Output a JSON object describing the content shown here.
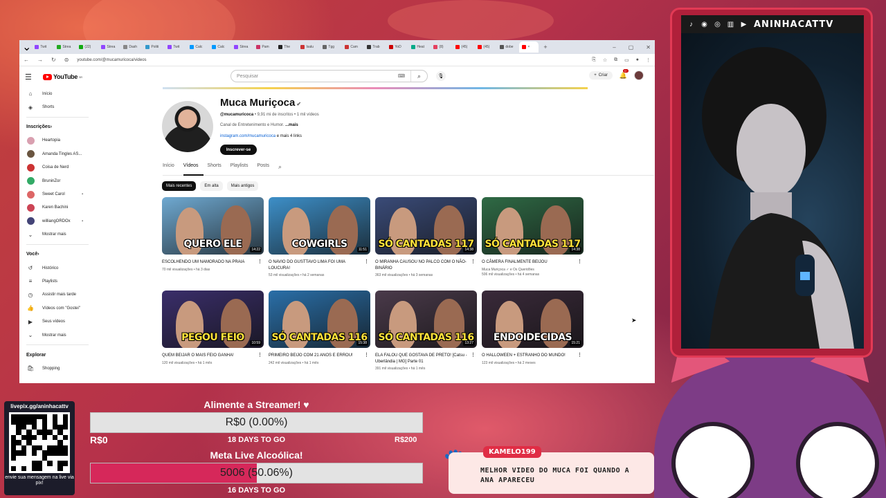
{
  "browser": {
    "tabs": [
      "Twit",
      "Strea",
      "(22)",
      "Strea",
      "Dash",
      "Politi",
      "Twit",
      "Calc",
      "Calc",
      "Strea",
      "Pam",
      "The",
      "Isalu",
      "Tgg",
      "Cam",
      "Trab",
      "YoD",
      "Heat",
      "(8)",
      "(45)",
      "(45)",
      "dobe"
    ],
    "url": "youtube.com/@mucamuricoca/videos"
  },
  "masthead": {
    "logo": "YouTube",
    "region": "BR",
    "search_placeholder": "Pesquisar",
    "create": "Criar",
    "notifications": "9+"
  },
  "sidebar": {
    "nav": [
      {
        "label": "Início",
        "icon": "home-icon"
      },
      {
        "label": "Shorts",
        "icon": "shorts-icon"
      }
    ],
    "subs_header": "Inscrições",
    "subs": [
      {
        "label": "Heartopia",
        "color": "#d9a0b0"
      },
      {
        "label": "Amanda Tingles AS...",
        "color": "#6a5540"
      },
      {
        "label": "Coisa de Nerd",
        "color": "#c33"
      },
      {
        "label": "BruninZor",
        "color": "#3a6"
      },
      {
        "label": "Sweet Carol",
        "color": "#d66"
      },
      {
        "label": "Karen Bachini",
        "color": "#c45"
      },
      {
        "label": "williangORDOx",
        "color": "#447"
      }
    ],
    "show_more": "Mostrar mais",
    "you_header": "Você",
    "you": [
      {
        "label": "Histórico",
        "icon": "history-icon"
      },
      {
        "label": "Playlists",
        "icon": "playlists-icon"
      },
      {
        "label": "Assistir mais tarde",
        "icon": "watch-later-icon"
      },
      {
        "label": "Vídeos com \"Gostei\"",
        "icon": "like-icon"
      },
      {
        "label": "Seus vídeos",
        "icon": "your-videos-icon"
      },
      {
        "label": "Mostrar mais",
        "icon": "chevron-down-icon"
      }
    ],
    "explore_header": "Explorar",
    "explore": [
      {
        "label": "Shopping",
        "icon": "shopping-icon"
      }
    ]
  },
  "channel": {
    "name": "Muca Muriçoca",
    "handle": "@mucamuricoca",
    "stats": " • 9,91 mi de inscritos • 1 mil vídeos",
    "desc": "Canal de Entretenimento e Humor.",
    "more": " ...mais",
    "link": "instagram.com/mucamuricoca",
    "link_more": " e mais 4 links",
    "subscribe": "Inscrever-se",
    "tabs": [
      "Início",
      "Vídeos",
      "Shorts",
      "Playlists",
      "Posts"
    ],
    "chips": [
      "Mais recentes",
      "Em alta",
      "Mais antigos"
    ]
  },
  "videos": [
    {
      "cap": "QUERO ELE",
      "dur": "14:22",
      "title": "ESCOLHENDO UM NAMORADO NA PRAIA",
      "meta": "70 mil visualizações • há 3 dias",
      "bg": "#6fa9d1",
      "yellow": false
    },
    {
      "cap": "COWGIRLS",
      "dur": "11:51",
      "title": "O NAVIO DO GUSTTAVO LIMA FOI UMA LOUCURA!",
      "meta": "53 mil visualizações • há 2 semanas",
      "bg": "#3d8fc8",
      "yellow": false
    },
    {
      "cap": "SÓ CANTADAS 117",
      "dur": "14:38",
      "title": "O MIRANHA CAUSOU NO PALCO COM O NÃO-BINÁRIO",
      "meta": "363 mil visualizações • há 3 semanas",
      "bg": "#3a4b78",
      "yellow": true
    },
    {
      "cap": "SÓ CANTADAS 117",
      "dur": "14:38",
      "title": "O CÂMERA FINALMENTE BEIJOU",
      "meta": "Muca Muriçoca ✓ e Os Queridões\n506 mil visualizações • há 4 semanas",
      "bg": "#2f6a45",
      "yellow": true
    },
    {
      "cap": "PEGOU FEIO",
      "dur": "10:59",
      "title": "QUEM BEIJAR O MAIS FEIO GANHA!",
      "meta": "120 mil visualizações • há 1 mês",
      "bg": "#3a2e6a",
      "yellow": true
    },
    {
      "cap": "SÓ CANTADAS 116",
      "dur": "15:38",
      "title": "PRIMEIRO BEIJO COM 21 ANOS E ERROU!",
      "meta": "242 mil visualizações • há 1 mês",
      "bg": "#2a6fa8",
      "yellow": true
    },
    {
      "cap": "SÓ CANTADAS 116",
      "dur": "13:27",
      "title": "ELA FALOU QUE GOSTAVA DE PRETO! [Catsu - Uberlândia | MG] Parte 01",
      "meta": "391 mil visualizações • há 1 mês",
      "bg": "#4a3a4a",
      "yellow": true
    },
    {
      "cap": "ENDOIDECIDAS",
      "dur": "15:21",
      "title": "O HALLOWEEN + ESTRANHO DO MUNDO!",
      "meta": "123 mil visualizações • há 2 meses",
      "bg": "#3a2a3a",
      "yellow": false
    }
  ],
  "overlay": {
    "streamer_name": "ANINHACATTV",
    "livepix_url": "livepix.gg/aninhacattv",
    "livepix_msg": "envie sua mensagem na live via pix!",
    "goal1": {
      "title": "Alimente a Streamer! ♥",
      "label": "R$0 (0.00%)",
      "progress": 0,
      "min": "R$0",
      "days": "18 DAYS TO GO",
      "max": "R$200"
    },
    "goal2": {
      "title": "Meta Live Alcoólica!",
      "label": "5006 (50.06%)",
      "progress": 50.06,
      "days": "16 DAYS TO GO"
    },
    "chat": {
      "user": "KAMELO199",
      "msg": "MELHOR VIDEO DO MUCA FOI QUANDO A ANA APARECEU"
    }
  }
}
